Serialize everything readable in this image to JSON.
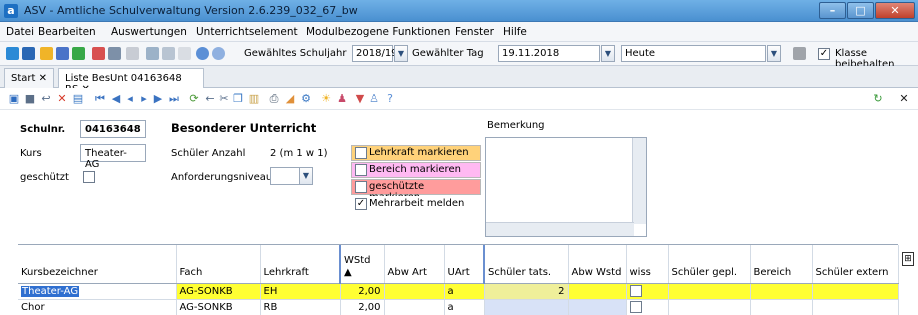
{
  "window": {
    "title": "ASV - Amtliche Schulverwaltung Version 2.6.239_032_67_bw",
    "app_icon": "a",
    "colors": {
      "titlebar": "#4a90d0",
      "close": "#c0412c"
    }
  },
  "menubar": {
    "items": [
      "Datei",
      "Bearbeiten",
      "Auswertungen",
      "Unterrichtselement",
      "Modulbezogene Funktionen",
      "Fenster",
      "Hilfe"
    ]
  },
  "toolbar": {
    "schoolyear_label": "Gewähltes Schuljahr",
    "schoolyear_value": "2018/19",
    "day_label": "Gewählter Tag",
    "day_value": "19.11.2018",
    "preset_value": "Heute",
    "keep_class_label": "Klasse beibehalten",
    "keep_class_checked": true
  },
  "tabs": [
    {
      "label": "Start",
      "close": "✕"
    },
    {
      "label": "Liste BesUnt 04163648 RS",
      "close": "✕"
    }
  ],
  "form": {
    "schulnr_label": "Schulnr.",
    "schulnr_value": "04163648",
    "header_title": "Besonderer Unterricht",
    "kurs_label": "Kurs",
    "kurs_value": "Theater-AG",
    "schueler_anzahl_label": "Schüler Anzahl",
    "schueler_anzahl_value": "2 (m 1 w 1)",
    "geschuetzt_label": "geschützt",
    "anforderungsniveau_label": "Anforderungsniveau",
    "bemerkung_label": "Bemerkung",
    "marks": [
      {
        "label": "Lehrkraft markieren",
        "color": "#ffd27a"
      },
      {
        "label": "Bereich markieren",
        "color": "#ffb9f2"
      },
      {
        "label": "geschützte markieren",
        "color": "#ff9c9c"
      },
      {
        "label": "Mehrarbeit melden",
        "color": "#ffffff",
        "checked": true
      }
    ]
  },
  "grid": {
    "columns": [
      "Kursbezeichner",
      "Fach",
      "Lehrkraft",
      "WStd",
      "Abw Art",
      "UArt",
      "Schüler tats.",
      "Abw Wstd",
      "wiss",
      "Schüler gepl.",
      "Bereich",
      "Schüler extern"
    ],
    "rows": [
      {
        "kursbezeichner": "Theater-AG",
        "fach": "AG-SONKB",
        "lehrkraft": "EH",
        "wstd": "2,00",
        "abw_art": "",
        "uart": "a",
        "schueler_tats": "2",
        "abw_wstd": "",
        "wiss": "",
        "schueler_gepl": "",
        "bereich": "",
        "schueler_extern": ""
      },
      {
        "kursbezeichner": "Chor",
        "fach": "AG-SONKB",
        "lehrkraft": "RB",
        "wstd": "2,00",
        "abw_art": "",
        "uart": "a",
        "schueler_tats": "",
        "abw_wstd": "",
        "wiss": "",
        "schueler_gepl": "",
        "bereich": "",
        "schueler_extern": ""
      }
    ],
    "colors": {
      "selected_row": "#ffff33",
      "highlight_cell": "#d8e2f7"
    }
  }
}
